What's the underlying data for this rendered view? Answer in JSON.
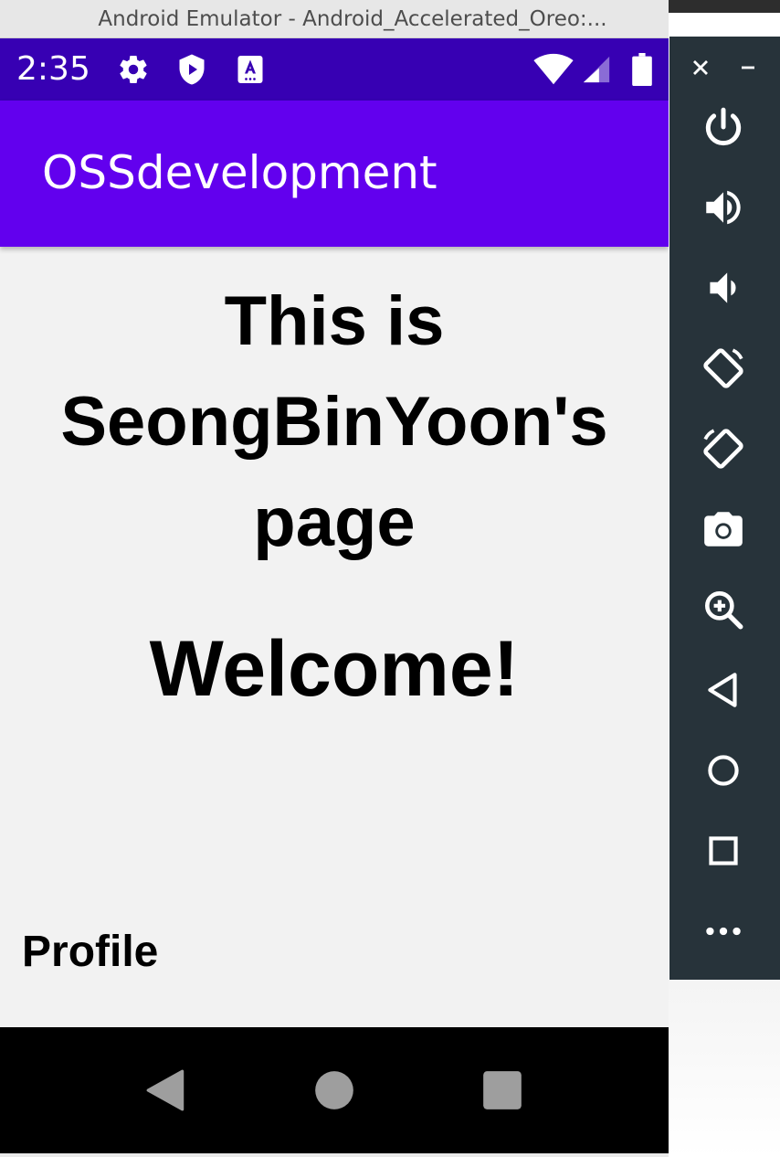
{
  "window": {
    "title": "Android Emulator - Android_Accelerated_Oreo:..."
  },
  "status_bar": {
    "time": "2:35",
    "icons": [
      "settings-icon",
      "play-protect-icon",
      "accessibility-a-icon",
      "wifi-icon",
      "cell-signal-icon",
      "battery-icon"
    ]
  },
  "app_bar": {
    "title": "OSSdevelopment"
  },
  "content": {
    "heading_lines": [
      "This is",
      "SeongBinYoon's",
      "page"
    ],
    "welcome": "Welcome!",
    "profile": "Profile"
  },
  "nav_bar": {
    "buttons": [
      "back-icon",
      "home-icon",
      "recents-icon"
    ]
  },
  "emulator_toolbar": {
    "buttons": [
      "close-icon",
      "minimize-icon",
      "power-icon",
      "volume-up-icon",
      "volume-down-icon",
      "rotate-left-icon",
      "rotate-right-icon",
      "camera-icon",
      "zoom-icon",
      "back-icon",
      "home-icon",
      "overview-icon",
      "more-icon"
    ]
  },
  "colors": {
    "status_bar": "#3700b3",
    "app_bar": "#6200ee",
    "background": "#f2f2f2",
    "toolbar": "#27333a"
  }
}
